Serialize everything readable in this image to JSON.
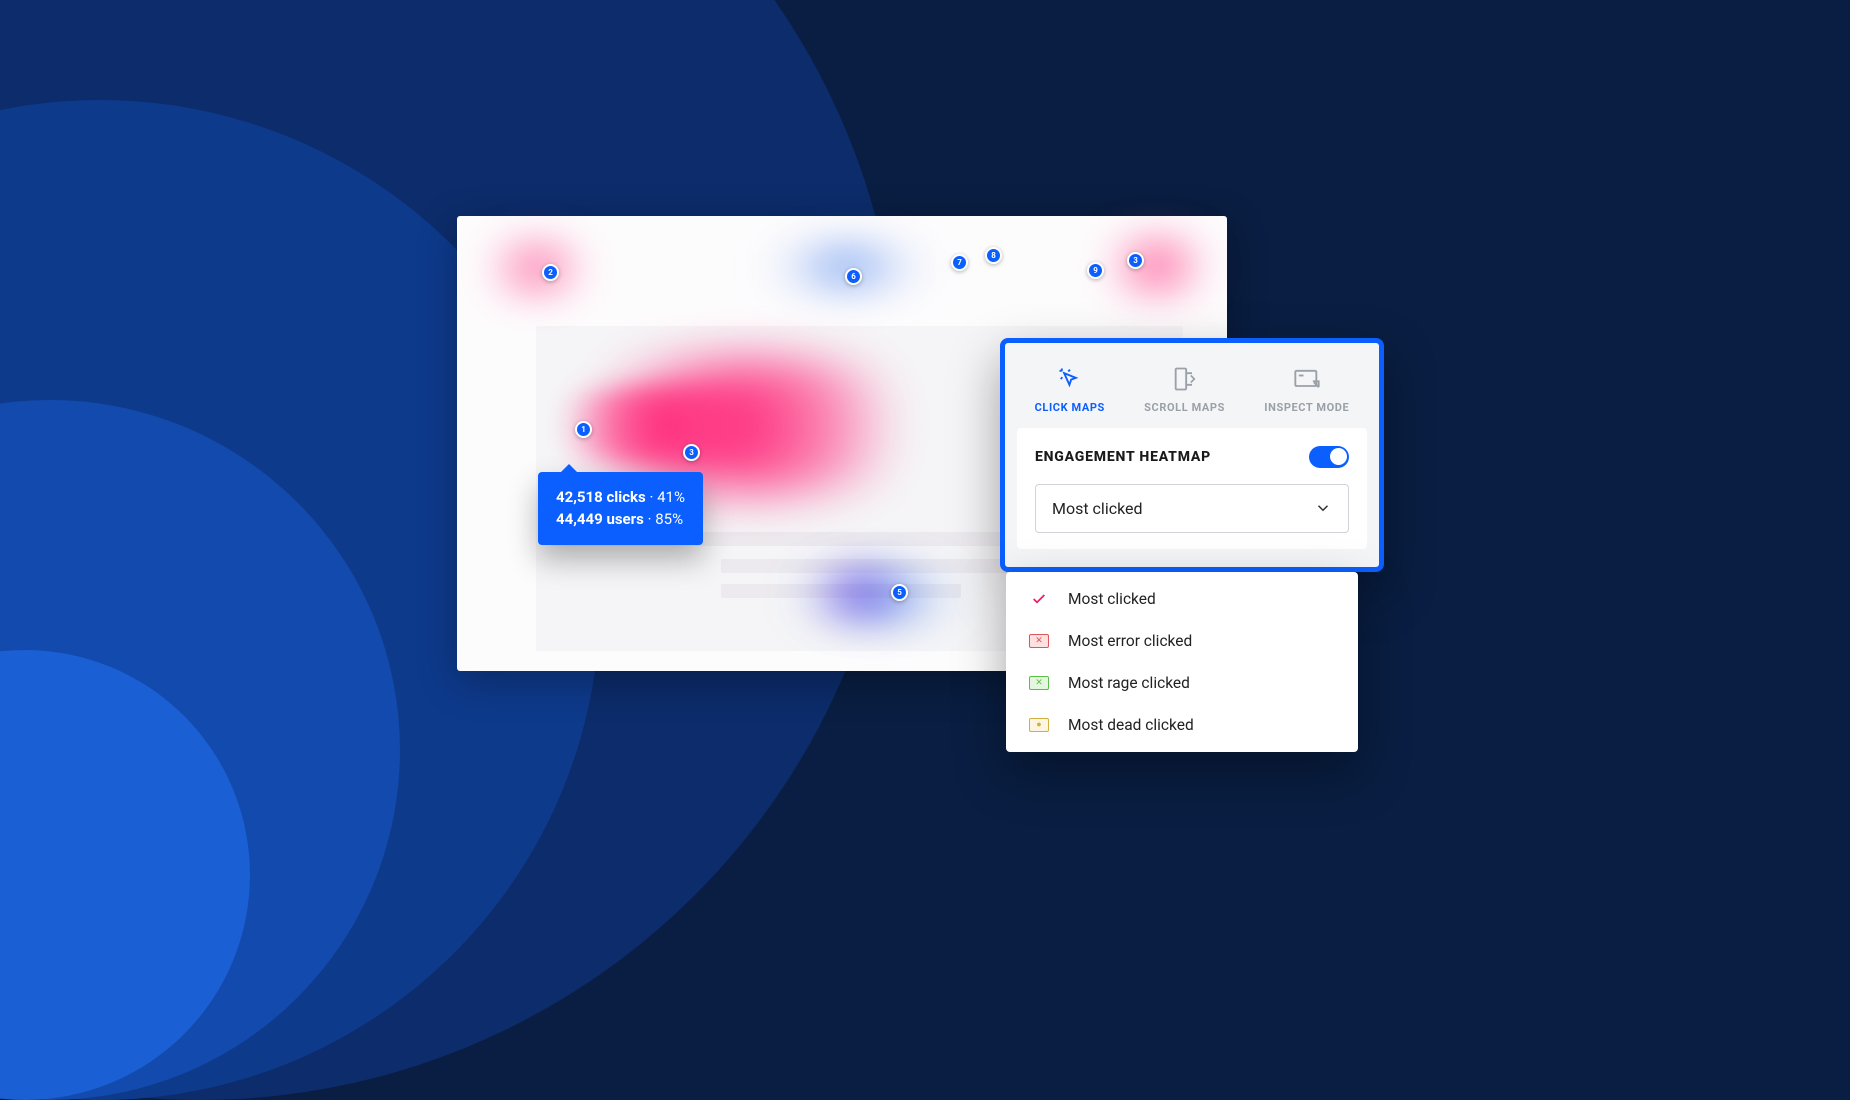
{
  "tooltip": {
    "clicks_value": "42,518 clicks",
    "clicks_pct": "· 41%",
    "users_value": "44,449 users",
    "users_pct": "· 85%"
  },
  "pins": {
    "p1": "1",
    "p2": "2",
    "p3": "3",
    "p3b": "3",
    "p5": "5",
    "p6": "6",
    "p7": "7",
    "p8": "8",
    "p9": "9"
  },
  "panel": {
    "tabs": {
      "click": "CLICK MAPS",
      "scroll": "SCROLL MAPS",
      "inspect": "INSPECT MODE"
    },
    "section_title": "ENGAGEMENT HEATMAP",
    "select_value": "Most clicked"
  },
  "dropdown": {
    "opt1": "Most clicked",
    "opt2": "Most error clicked",
    "opt3": "Most rage clicked",
    "opt4": "Most dead clicked"
  }
}
